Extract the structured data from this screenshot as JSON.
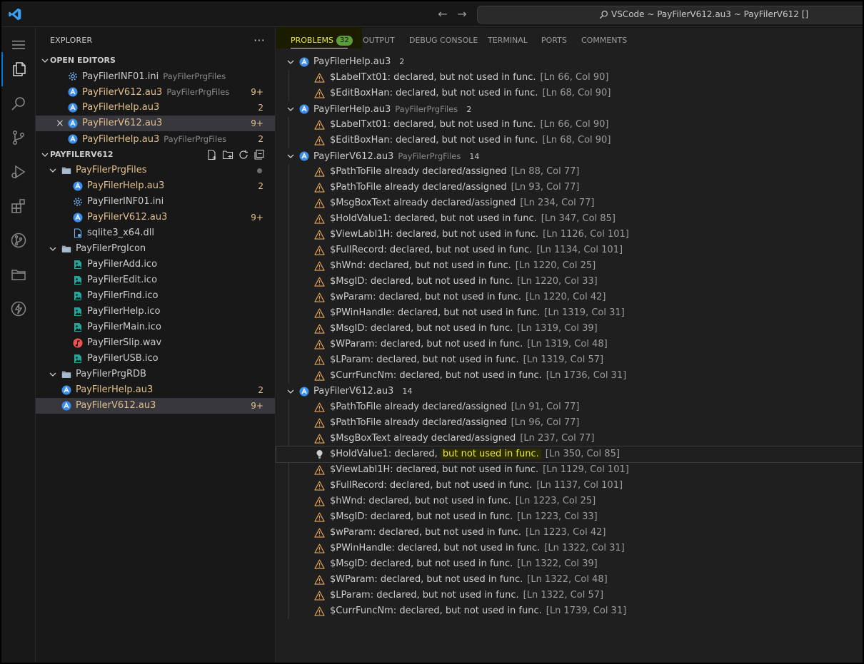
{
  "titlebar": {
    "command_center_text": "VSCode ~ PayFilerV612.au3 ~ PayFilerV612 []",
    "back_label": "←",
    "forward_label": "→"
  },
  "explorer": {
    "title": "EXPLORER",
    "more_label": "···",
    "open_editors_header": "OPEN EDITORS",
    "open_editors": [
      {
        "name": "PayFilerINF01.ini",
        "desc": "PayFilerPrgFiles",
        "badge": "",
        "icon": "gear-icon",
        "state": "plain"
      },
      {
        "name": "PayFilerV612.au3",
        "desc": "PayFilerPrgFiles",
        "badge": "9+",
        "icon": "autoit-icon",
        "state": "mod"
      },
      {
        "name": "PayFilerHelp.au3",
        "desc": "",
        "badge": "2",
        "icon": "autoit-icon",
        "state": "mod"
      },
      {
        "name": "PayFilerV612.au3",
        "desc": "",
        "badge": "9+",
        "icon": "autoit-icon",
        "state": "mod",
        "selected": true,
        "close": "×"
      },
      {
        "name": "PayFilerHelp.au3",
        "desc": "PayFilerPrgFiles",
        "badge": "2",
        "icon": "autoit-icon",
        "state": "mod"
      }
    ],
    "workspace_header": "PAYFILERV612",
    "tree": [
      {
        "name": "PayFilerPrgFiles",
        "type": "folder",
        "depth": 0,
        "state": "mod",
        "badge": "",
        "dot": true
      },
      {
        "name": "PayFilerHelp.au3",
        "type": "autoit",
        "depth": 1,
        "state": "mod",
        "badge": "2"
      },
      {
        "name": "PayFilerINF01.ini",
        "type": "ini",
        "depth": 1,
        "state": "plain",
        "badge": ""
      },
      {
        "name": "PayFilerV612.au3",
        "type": "autoit",
        "depth": 1,
        "state": "mod",
        "badge": "9+"
      },
      {
        "name": "sqlite3_x64.dll",
        "type": "dll",
        "depth": 1,
        "state": "plain",
        "badge": ""
      },
      {
        "name": "PayFilerPrgIcon",
        "type": "folder",
        "depth": 0,
        "state": "plain",
        "badge": ""
      },
      {
        "name": "PayFilerAdd.ico",
        "type": "image",
        "depth": 1,
        "state": "plain",
        "badge": ""
      },
      {
        "name": "PayFilerEdit.ico",
        "type": "image",
        "depth": 1,
        "state": "plain",
        "badge": ""
      },
      {
        "name": "PayFilerFind.ico",
        "type": "image",
        "depth": 1,
        "state": "plain",
        "badge": ""
      },
      {
        "name": "PayFilerHelp.ico",
        "type": "image",
        "depth": 1,
        "state": "plain",
        "badge": ""
      },
      {
        "name": "PayFilerMain.ico",
        "type": "image",
        "depth": 1,
        "state": "plain",
        "badge": ""
      },
      {
        "name": "PayFilerSlip.wav",
        "type": "audio",
        "depth": 1,
        "state": "plain",
        "badge": ""
      },
      {
        "name": "PayFilerUSB.ico",
        "type": "image",
        "depth": 1,
        "state": "plain",
        "badge": ""
      },
      {
        "name": "PayFilerPrgRDB",
        "type": "folder",
        "depth": 0,
        "state": "plain",
        "badge": ""
      },
      {
        "name": "PayFilerHelp.au3",
        "type": "autoit",
        "depth": 0,
        "state": "mod",
        "badge": "2"
      },
      {
        "name": "PayFilerV612.au3",
        "type": "autoit",
        "depth": 0,
        "state": "mod",
        "badge": "9+",
        "selected": true
      }
    ]
  },
  "panel": {
    "tabs": {
      "problems": "PROBLEMS",
      "problems_count": "32",
      "output": "OUTPUT",
      "debug_console": "DEBUG CONSOLE",
      "terminal": "TERMINAL",
      "ports": "PORTS",
      "comments": "COMMENTS"
    },
    "groups": [
      {
        "file": "PayFilerHelp.au3",
        "desc": "",
        "count": "2",
        "items": [
          {
            "msg": "$LabelTxt01: declared, but not used in func.",
            "loc": "[Ln 66, Col 90]"
          },
          {
            "msg": "$EditBoxHan: declared, but not used in func.",
            "loc": "[Ln 68, Col 90]"
          }
        ]
      },
      {
        "file": "PayFilerHelp.au3",
        "desc": "PayFilerPrgFiles",
        "count": "2",
        "items": [
          {
            "msg": "$LabelTxt01: declared, but not used in func.",
            "loc": "[Ln 66, Col 90]"
          },
          {
            "msg": "$EditBoxHan: declared, but not used in func.",
            "loc": "[Ln 68, Col 90]"
          }
        ]
      },
      {
        "file": "PayFilerV612.au3",
        "desc": "PayFilerPrgFiles",
        "count": "14",
        "items": [
          {
            "msg": "$PathToFile already declared/assigned",
            "loc": "[Ln 88, Col 77]"
          },
          {
            "msg": "$PathToFile already declared/assigned",
            "loc": "[Ln 93, Col 77]"
          },
          {
            "msg": "$MsgBoxText already declared/assigned",
            "loc": "[Ln 234, Col 77]"
          },
          {
            "msg": "$HoldValue1: declared, but not used in func.",
            "loc": "[Ln 347, Col 85]"
          },
          {
            "msg": "$ViewLabl1H: declared, but not used in func.",
            "loc": "[Ln 1126, Col 101]"
          },
          {
            "msg": "$FullRecord: declared, but not used in func.",
            "loc": "[Ln 1134, Col 101]"
          },
          {
            "msg": "$hWnd: declared, but not used in func.",
            "loc": "[Ln 1220, Col 25]"
          },
          {
            "msg": "$MsgID: declared, but not used in func.",
            "loc": "[Ln 1220, Col 33]"
          },
          {
            "msg": "$wParam: declared, but not used in func.",
            "loc": "[Ln 1220, Col 42]"
          },
          {
            "msg": "$PWinHandle: declared, but not used in func.",
            "loc": "[Ln 1319, Col 31]"
          },
          {
            "msg": "$MsgID: declared, but not used in func.",
            "loc": "[Ln 1319, Col 39]"
          },
          {
            "msg": "$WParam: declared, but not used in func.",
            "loc": "[Ln 1319, Col 48]"
          },
          {
            "msg": "$LParam: declared, but not used in func.",
            "loc": "[Ln 1319, Col 57]"
          },
          {
            "msg": "$CurrFuncNm: declared, but not used in func.",
            "loc": "[Ln 1736, Col 31]"
          }
        ]
      },
      {
        "file": "PayFilerV612.au3",
        "desc": "",
        "count": "14",
        "items": [
          {
            "msg": "$PathToFile already declared/assigned",
            "loc": "[Ln 91, Col 77]"
          },
          {
            "msg": "$PathToFile already declared/assigned",
            "loc": "[Ln 96, Col 77]"
          },
          {
            "msg": "$MsgBoxText already declared/assigned",
            "loc": "[Ln 237, Col 77]"
          },
          {
            "msg": "$HoldValue1: declared,",
            "msg_hl": "but not used in func.",
            "loc": "[Ln 350, Col 85]",
            "focused": true
          },
          {
            "msg": "$ViewLabl1H: declared, but not used in func.",
            "loc": "[Ln 1129, Col 101]"
          },
          {
            "msg": "$FullRecord: declared, but not used in func.",
            "loc": "[Ln 1137, Col 101]"
          },
          {
            "msg": "$hWnd: declared, but not used in func.",
            "loc": "[Ln 1223, Col 25]"
          },
          {
            "msg": "$MsgID: declared, but not used in func.",
            "loc": "[Ln 1223, Col 33]"
          },
          {
            "msg": "$wParam: declared, but not used in func.",
            "loc": "[Ln 1223, Col 42]"
          },
          {
            "msg": "$PWinHandle: declared, but not used in func.",
            "loc": "[Ln 1322, Col 31]"
          },
          {
            "msg": "$MsgID: declared, but not used in func.",
            "loc": "[Ln 1322, Col 39]"
          },
          {
            "msg": "$WParam: declared, but not used in func.",
            "loc": "[Ln 1322, Col 48]"
          },
          {
            "msg": "$LParam: declared, but not used in func.",
            "loc": "[Ln 1322, Col 57]"
          },
          {
            "msg": "$CurrFuncNm: declared, but not used in func.",
            "loc": "[Ln 1739, Col 31]"
          }
        ]
      }
    ]
  },
  "colors": {
    "accent": "#0078d4",
    "modified": "#e2c08d",
    "warning": "#cca700",
    "highlight": "#e8e84a",
    "badge_green": "#5c9f3a"
  }
}
